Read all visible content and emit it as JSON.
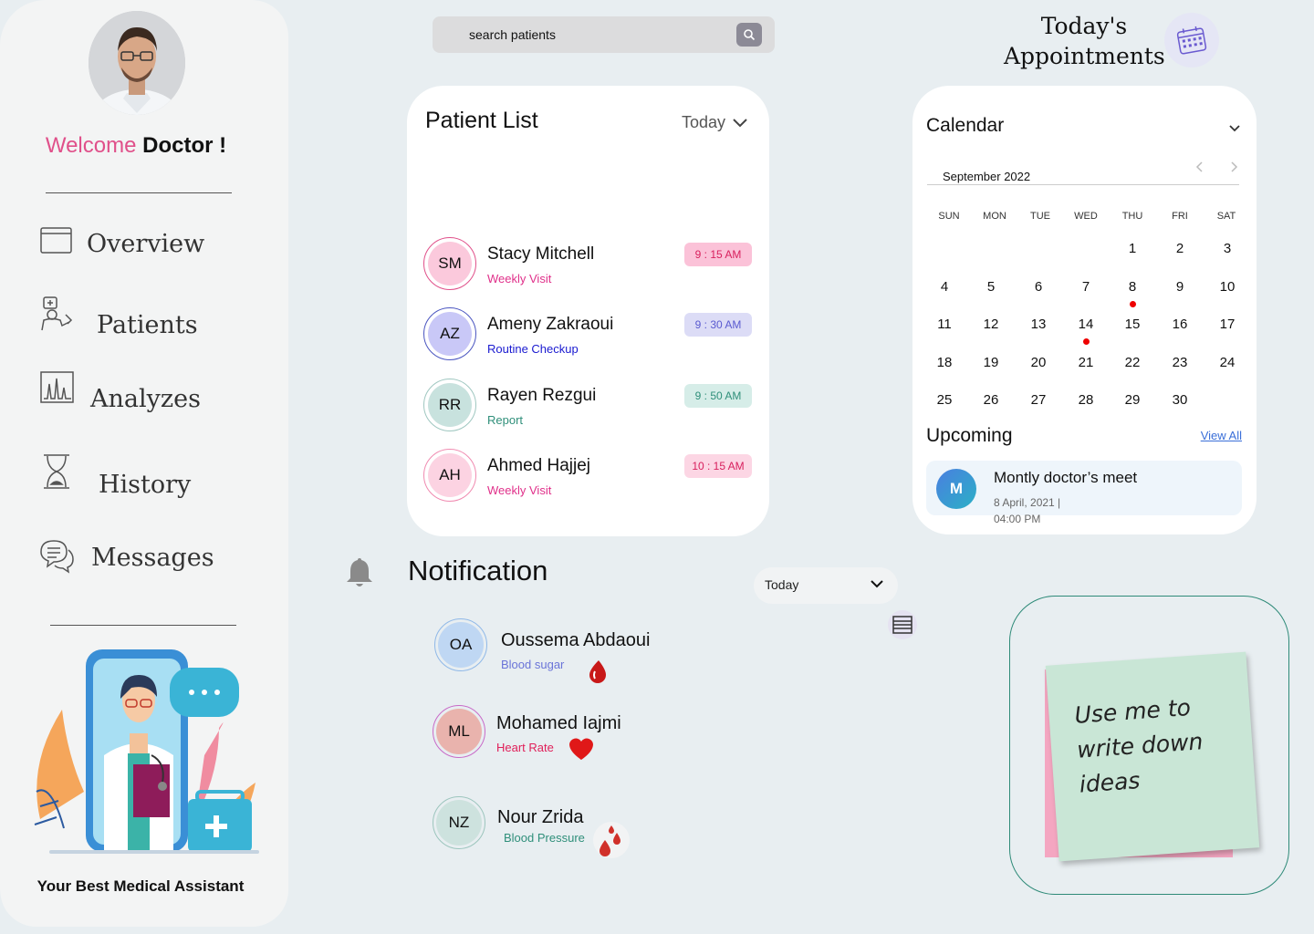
{
  "sidebar": {
    "welcome_prefix": "Welcome",
    "welcome_name": "Doctor !",
    "nav": [
      {
        "label": "Overview",
        "icon": "window-icon"
      },
      {
        "label": "Patients",
        "icon": "patient-icon"
      },
      {
        "label": "Analyzes",
        "icon": "chart-icon"
      },
      {
        "label": "History",
        "icon": "hourglass-icon"
      },
      {
        "label": "Messages",
        "icon": "chat-icon"
      }
    ],
    "tagline": "Your Best Medical Assistant"
  },
  "search": {
    "placeholder": "search patients"
  },
  "appointments": {
    "title_line1": "Today's",
    "title_line2": "Appointments"
  },
  "patient_list": {
    "title": "Patient List",
    "filter": "Today",
    "patients": [
      {
        "initials": "SM",
        "name": "Stacy Mitchell",
        "type": "Weekly Visit",
        "time": "9 : 15 AM"
      },
      {
        "initials": "AZ",
        "name": "Ameny Zakraoui",
        "type": "Routine Checkup",
        "time": "9 : 30 AM"
      },
      {
        "initials": "RR",
        "name": "Rayen Rezgui",
        "type": "Report",
        "time": "9 : 50 AM"
      },
      {
        "initials": "AH",
        "name": "Ahmed Hajjej",
        "type": "Weekly Visit",
        "time": "10 : 15 AM"
      }
    ]
  },
  "calendar": {
    "title": "Calendar",
    "month": "September 2022",
    "weekdays": [
      "SUN",
      "MON",
      "TUE",
      "WED",
      "THU",
      "FRI",
      "SAT"
    ],
    "first_weekday_index": 4,
    "days_in_month": 30,
    "marked_days": [
      8,
      14
    ]
  },
  "upcoming": {
    "title": "Upcoming",
    "view_all": "View All",
    "item": {
      "avatar": "M",
      "name": "Montly doctor’s meet",
      "date": "8 April, 2021  |  04:00 PM"
    }
  },
  "notification": {
    "title": "Notification",
    "filter": "Today",
    "items": [
      {
        "initials": "OA",
        "name": "Oussema Abdaoui",
        "type": "Blood sugar",
        "icon": "blood-drop-icon"
      },
      {
        "initials": "ML",
        "name": "Mohamed Iajmi",
        "type": "Heart Rate",
        "icon": "heart-icon"
      },
      {
        "initials": "NZ",
        "name": "Nour Zrida",
        "type": "Blood Pressure",
        "icon": "blood-drops-icon"
      }
    ]
  },
  "sticky_note": {
    "text_line1": "Use me to",
    "text_line2": "write down",
    "text_line3": "ideas"
  },
  "colors": {
    "accent_pink": "#e0508a",
    "routine_blue": "#1a1ad0",
    "report_teal": "#2f8f7a"
  }
}
